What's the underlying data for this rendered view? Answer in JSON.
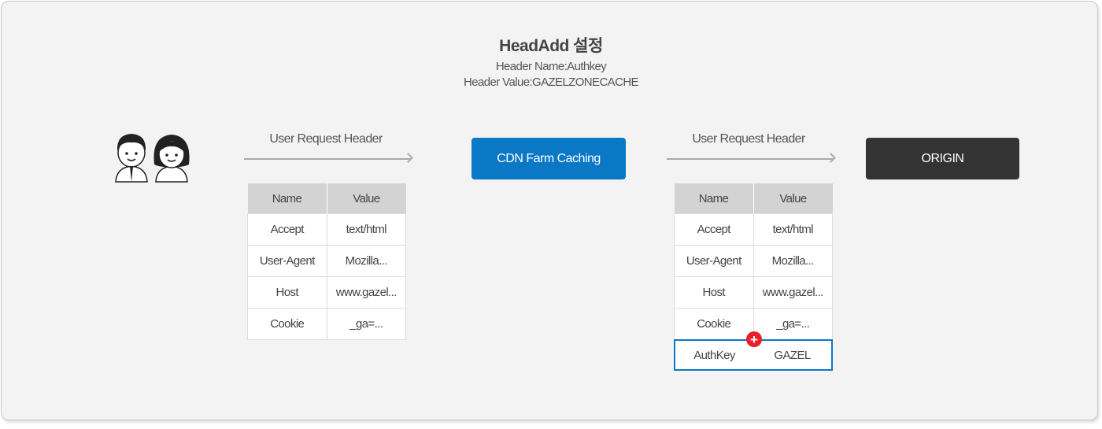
{
  "title": "HeadAdd 설정",
  "header_name_line": "Header Name:Authkey",
  "header_value_line": "Header Value:GAZELZONECACHE",
  "arrow1_label": "User Request Header",
  "arrow2_label": "User Request Header",
  "cdn_box": "CDN Farm Caching",
  "origin_box": "ORIGIN",
  "table_left": {
    "headers": [
      "Name",
      "Value"
    ],
    "rows": [
      [
        "Accept",
        "text/html"
      ],
      [
        "User-Agent",
        "Mozilla..."
      ],
      [
        "Host",
        "www.gazel..."
      ],
      [
        "Cookie",
        "_ga=..."
      ]
    ]
  },
  "table_right": {
    "headers": [
      "Name",
      "Value"
    ],
    "rows": [
      [
        "Accept",
        "text/html"
      ],
      [
        "User-Agent",
        "Mozilla..."
      ],
      [
        "Host",
        "www.gazel..."
      ],
      [
        "Cookie",
        "_ga=..."
      ]
    ],
    "added_row": [
      "AuthKey",
      "GAZEL"
    ]
  },
  "plus_symbol": "+",
  "icons": [
    "users-icon",
    "plus-icon"
  ],
  "colors": {
    "cdn": "#0b78c6",
    "origin": "#333333",
    "highlight": "#0b78c6",
    "plus": "#e8202a"
  }
}
